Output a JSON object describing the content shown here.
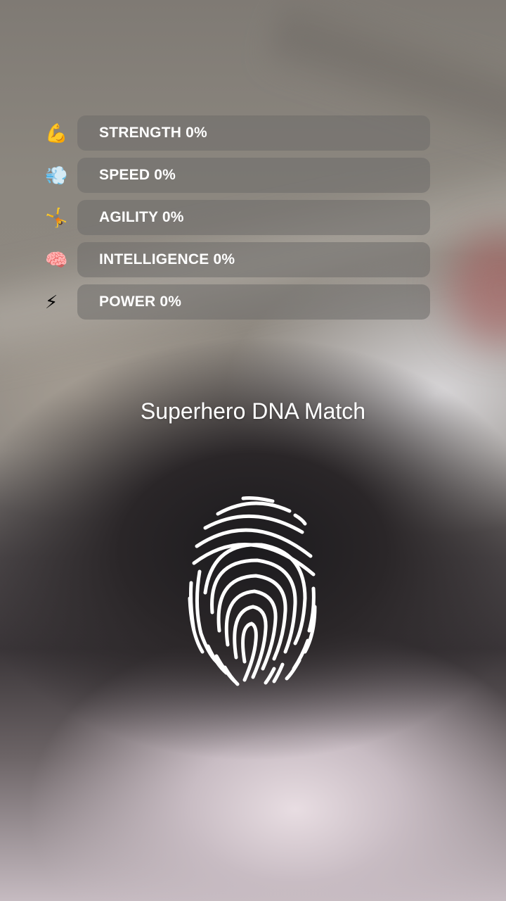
{
  "stats": [
    {
      "icon": "💪",
      "icon_name": "flexed-biceps-icon",
      "label": "STRENGTH 0%",
      "value": 0
    },
    {
      "icon": "💨",
      "icon_name": "dash-wind-icon",
      "label": "SPEED 0%",
      "value": 0
    },
    {
      "icon": "🤸",
      "icon_name": "cartwheel-icon",
      "label": "AGILITY 0%",
      "value": 0
    },
    {
      "icon": "🧠",
      "icon_name": "brain-icon",
      "label": "INTELLIGENCE 0%",
      "value": 0
    },
    {
      "icon": "⚡",
      "icon_name": "lightning-icon",
      "label": "POWER 0%",
      "value": 0
    }
  ],
  "title": "Superhero DNA Match",
  "colors": {
    "text": "#ffffff",
    "bar_background": "#6e6c6a"
  }
}
